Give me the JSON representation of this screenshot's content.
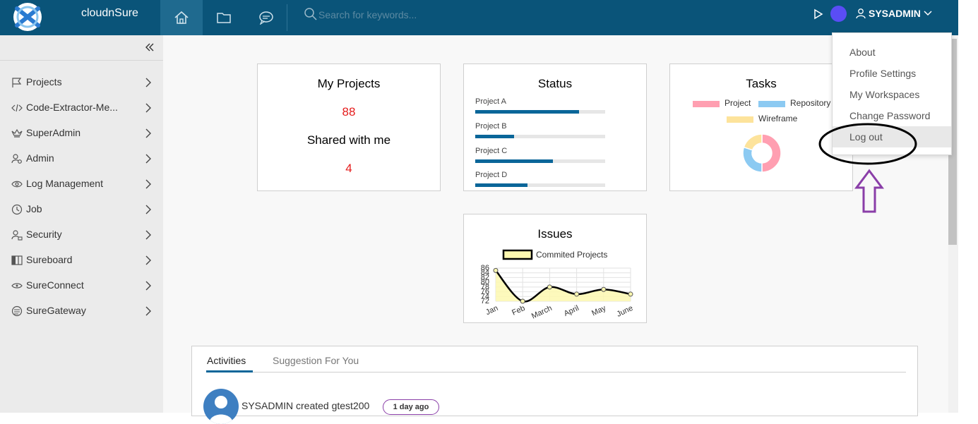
{
  "header": {
    "brand": "cloudnSure",
    "search_placeholder": "Search for keywords...",
    "username": "SYSADMIN",
    "nav_icons": [
      "home-icon",
      "folder-icon",
      "chat-icon"
    ]
  },
  "sidebar": {
    "items": [
      {
        "label": "Projects",
        "icon": "flag-icon"
      },
      {
        "label": "Code-Extractor-Me...",
        "icon": "code-icon"
      },
      {
        "label": "SuperAdmin",
        "icon": "crown-icon"
      },
      {
        "label": "Admin",
        "icon": "user-gear-icon"
      },
      {
        "label": "Log Management",
        "icon": "eye-icon"
      },
      {
        "label": "Job",
        "icon": "clock-icon"
      },
      {
        "label": "Security",
        "icon": "user-lock-icon"
      },
      {
        "label": "Sureboard",
        "icon": "board-icon"
      },
      {
        "label": "SureConnect",
        "icon": "connect-icon"
      },
      {
        "label": "SureGateway",
        "icon": "gateway-icon"
      }
    ]
  },
  "cards": {
    "my_projects": {
      "title": "My Projects",
      "count": "88",
      "shared_title": "Shared with me",
      "shared_count": "4"
    },
    "status": {
      "title": "Status",
      "projects": [
        {
          "name": "Project A",
          "progress": 0.8
        },
        {
          "name": "Project B",
          "progress": 0.3
        },
        {
          "name": "Project C",
          "progress": 0.6
        },
        {
          "name": "Project D",
          "progress": 0.4
        }
      ]
    },
    "tasks": {
      "title": "Tasks",
      "legend": [
        {
          "label": "Project",
          "color": "#ff9fb1"
        },
        {
          "label": "Repository",
          "color": "#8ccaf2"
        },
        {
          "label": "Wireframe",
          "color": "#fde39b"
        }
      ]
    },
    "issues": {
      "title": "Issues"
    }
  },
  "chart_data": {
    "type": "line",
    "title": "Issues",
    "categories": [
      "Jan",
      "Feb",
      "March",
      "April",
      "May",
      "June"
    ],
    "series": [
      {
        "name": "Commited Projects",
        "values": [
          85,
          72,
          78,
          75,
          77,
          75
        ]
      }
    ],
    "yticks": [
      "86",
      "84",
      "82",
      "80",
      "78",
      "76",
      "74",
      "72"
    ],
    "ylim": [
      72,
      86
    ],
    "fill_color": "#fdf8b0",
    "line_color": "#000000"
  },
  "tasks_chart": {
    "type": "pie",
    "slices": [
      {
        "label": "Project",
        "value": 50,
        "color": "#ff9fb1"
      },
      {
        "label": "Repository",
        "value": 30,
        "color": "#8ccaf2"
      },
      {
        "label": "Wireframe",
        "value": 20,
        "color": "#fde39b"
      }
    ]
  },
  "activities": {
    "tabs": [
      "Activities",
      "Suggestion For You"
    ],
    "entries": [
      {
        "text": "SYSADMIN created gtest200",
        "time": "1 day ago"
      }
    ]
  },
  "user_dropdown": {
    "items": [
      "About",
      "Profile Settings",
      "My Workspaces",
      "Change Password",
      "Log out"
    ]
  },
  "colors": {
    "header_bg": "#0a5479",
    "accent": "#0a6699",
    "count_red": "#e51c1c",
    "annotation_arrow": "#8a3ea8"
  }
}
